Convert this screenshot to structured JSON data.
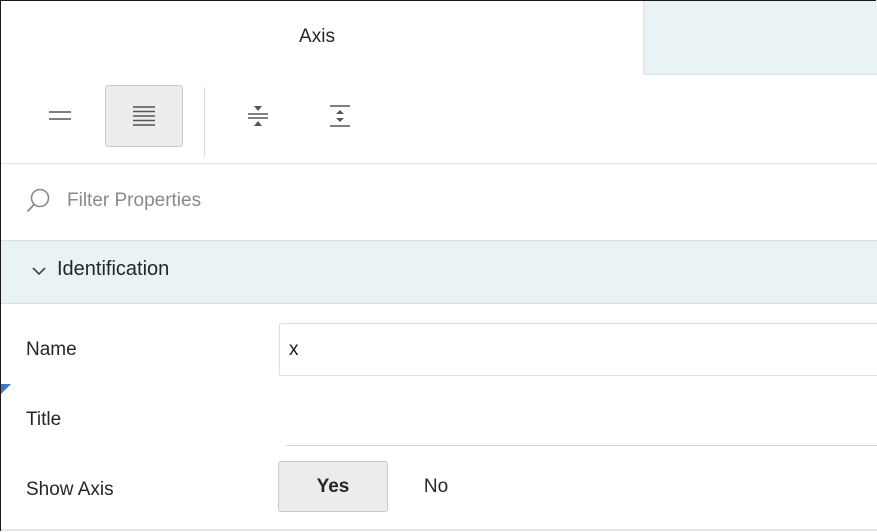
{
  "tabs": {
    "active_label": "Axis"
  },
  "toolbar": {
    "buttons": [
      {
        "icon": "collapsed-view-icon",
        "selected": false
      },
      {
        "icon": "expanded-view-icon",
        "selected": true
      },
      {
        "icon": "collapse-all-icon",
        "selected": false
      },
      {
        "icon": "expand-all-icon",
        "selected": false
      }
    ]
  },
  "filter": {
    "placeholder": "Filter Properties",
    "icon": "search-icon"
  },
  "section": {
    "title": "Identification",
    "expanded": true,
    "icon": "chevron-down-icon"
  },
  "properties": {
    "name": {
      "label": "Name",
      "value": "x"
    },
    "title": {
      "label": "Title",
      "value": ""
    },
    "show_axis": {
      "label": "Show Axis",
      "options": [
        "Yes",
        "No"
      ],
      "selected": "Yes"
    }
  },
  "colors": {
    "accent_bg": "#eaf3f3",
    "selected_button_bg": "#ececec",
    "marker": "#3b78c4"
  }
}
